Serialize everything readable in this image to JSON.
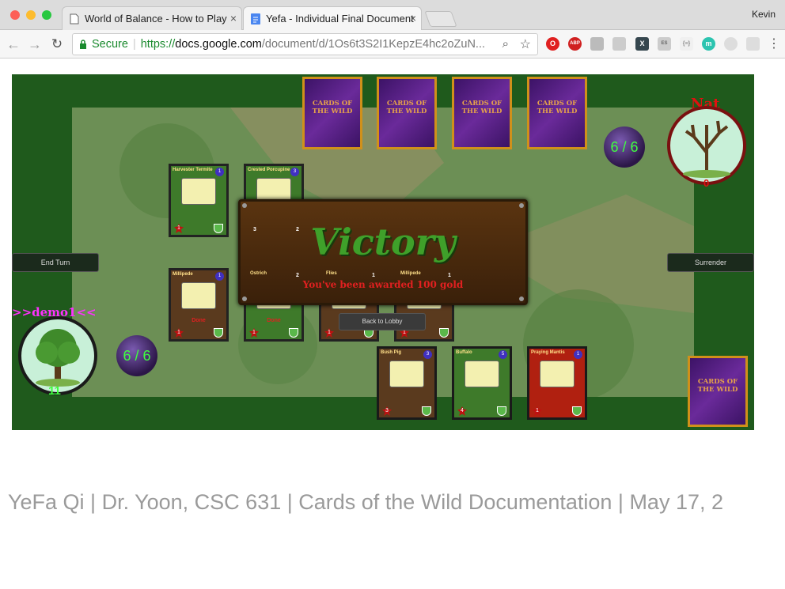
{
  "browser": {
    "tabs": [
      {
        "title": "World of Balance - How to Play",
        "active": false
      },
      {
        "title": "Yefa - Individual Final Document",
        "active": true
      }
    ],
    "profile_name": "Kevin",
    "secure_label": "Secure",
    "url_prefix": "https://",
    "url_host": "docs.google.com",
    "url_path": "/document/d/1Os6t3S2I1KepzE4hc2oZuN..."
  },
  "game": {
    "deck_label": "CARDS OF THE WILD",
    "end_turn_label": "End Turn",
    "surrender_label": "Surrender",
    "opponent": {
      "name": "Nat",
      "health": "0",
      "mana": "6 / 6"
    },
    "player": {
      "name": ">>demo1<<",
      "health": "11",
      "mana": "6 / 6"
    },
    "opponent_field": [
      {
        "name": "Harvester Termite",
        "cost": "1",
        "attack": "1"
      },
      {
        "name": "Crested Porcupine",
        "cost": "3",
        "attack": ""
      }
    ],
    "player_field": [
      {
        "name": "Millipede",
        "cost": "1",
        "attack": "1",
        "status": "Done"
      },
      {
        "name": "Ostrich",
        "cost": "2",
        "attack": "1",
        "status": "Done"
      },
      {
        "name": "Flies",
        "cost": "1",
        "attack": "1",
        "status": "Done"
      },
      {
        "name": "Millipede",
        "cost": "1",
        "attack": "1",
        "status": ""
      }
    ],
    "overlay_numbers": [
      "3",
      "2",
      "2",
      "1",
      "1"
    ],
    "hand": [
      {
        "name": "Bush Pig",
        "cost": "3",
        "attack": "3"
      },
      {
        "name": "Buffalo",
        "cost": "5",
        "attack": "4"
      },
      {
        "name": "Praying Mantis",
        "cost": "1",
        "attack": "1"
      }
    ],
    "victory": {
      "title": "Victory",
      "subtitle": "You've been awarded 100 gold",
      "back_button": "Back to Lobby"
    }
  },
  "document": {
    "footer": "YeFa Qi | Dr. Yoon, CSC 631 | Cards of the Wild Documentation  | May 17, 2"
  },
  "colors": {
    "victory_green": "#3fa02a",
    "gold_text": "#e02020",
    "mana_text": "#3fff3f",
    "player_name": "#ff30ff",
    "opponent_name": "#e01010"
  }
}
